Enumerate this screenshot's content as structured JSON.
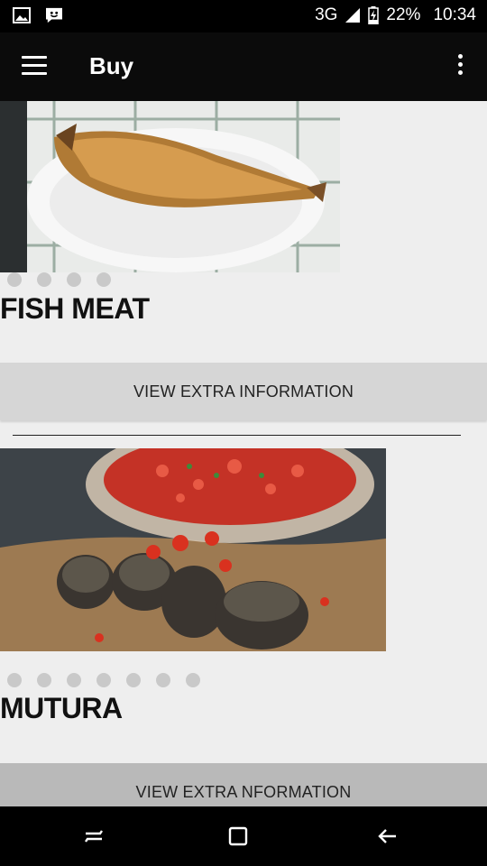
{
  "status_bar": {
    "network": "3G",
    "battery": "22%",
    "time": "10:34"
  },
  "app_bar": {
    "title": "Buy"
  },
  "items": [
    {
      "name": "FISH MEAT",
      "button_label": "VIEW EXTRA INFORMATION",
      "image_count": 4
    },
    {
      "name": "MUTURA",
      "button_label": "VIEW EXTRA NFORMATION",
      "image_count": 7
    }
  ]
}
